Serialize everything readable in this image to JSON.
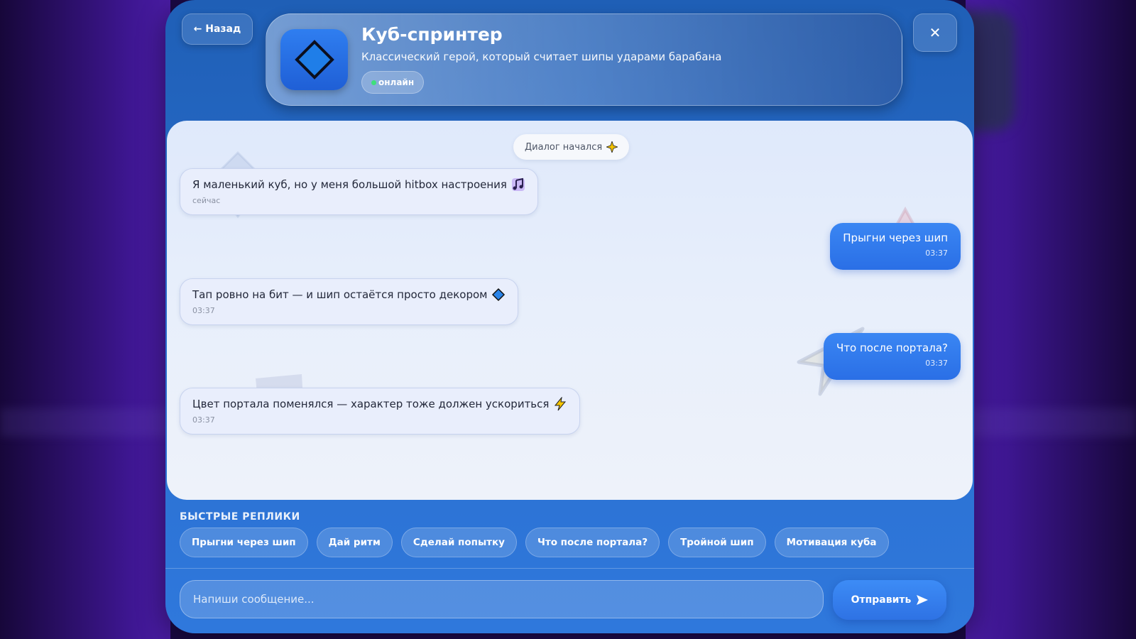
{
  "header": {
    "back_label": "← Назад",
    "close_label": "✕",
    "character": {
      "name": "Куб-спринтер",
      "description": "Классический герой, который считает шипы ударами барабана",
      "status": "онлайн"
    }
  },
  "chat": {
    "system_message": "Диалог начался",
    "messages": [
      {
        "from": "bot",
        "text": "Я маленький куб, но у меня большой hitbox настроения",
        "time": "сейчас",
        "emoji": "music-note-icon"
      },
      {
        "from": "user",
        "text": "Прыгни через шип",
        "time": "03:37"
      },
      {
        "from": "bot",
        "text": "Тап ровно на бит — и шип остаётся просто декором",
        "time": "03:37",
        "emoji": "diamond-icon"
      },
      {
        "from": "user",
        "text": "Что после портала?",
        "time": "03:37"
      },
      {
        "from": "bot",
        "text": "Цвет портала поменялся — характер тоже должен ускориться",
        "time": "03:37",
        "emoji": "lightning-icon"
      }
    ]
  },
  "quick_replies": {
    "title": "БЫСТРЫЕ РЕПЛИКИ",
    "items": [
      "Прыгни через шип",
      "Дай ритм",
      "Сделай попытку",
      "Что после портала?",
      "Тройной шип",
      "Мотивация куба"
    ]
  },
  "composer": {
    "placeholder": "Напиши сообщение...",
    "send_label": "Отправить"
  },
  "colors": {
    "accent": "#2a6fe6",
    "online": "#3fe07a",
    "modal_bg": "#2a6fcf"
  }
}
